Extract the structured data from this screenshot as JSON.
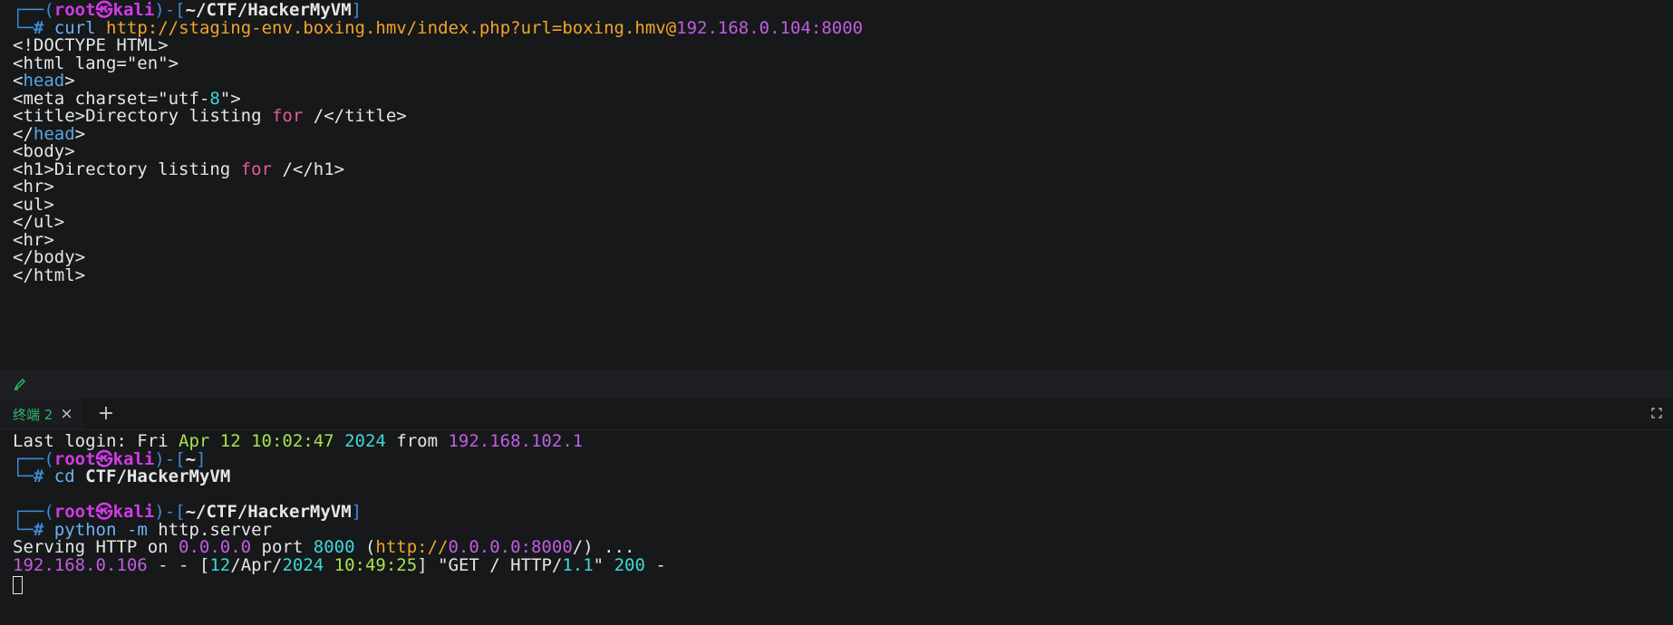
{
  "top_terminal": {
    "prompt": {
      "open": "┌──(",
      "user": "root㉿kali",
      "mid": ")-[",
      "path": "~/CTF/HackerMyVM",
      "close": "]",
      "corner": "└─",
      "hash": "#"
    },
    "command": {
      "name": "curl",
      "url_part": "http://staging-env.boxing.hmv/index.php?url=boxing.hmv@",
      "ip_port": "192.168.0.104:8000"
    },
    "output": {
      "l1": "<!DOCTYPE HTML>",
      "l2": "<html lang=\"en\">",
      "l3a": "<",
      "l3b": "head",
      "l3c": ">",
      "l4a": "<meta charset=\"utf-",
      "l4b": "8",
      "l4c": "\">",
      "l5a": "<title>Directory listing ",
      "l5b": "for",
      "l5c": " /</title>",
      "l6a": "</",
      "l6b": "head",
      "l6c": ">",
      "l7": "<body>",
      "l8a": "<h1>Directory listing ",
      "l8b": "for",
      "l8c": " /</h1>",
      "l9": "<hr>",
      "l10": "<ul>",
      "l11": "</ul>",
      "l12": "<hr>",
      "l13": "</body>",
      "l14": "</html>"
    }
  },
  "tabbar": {
    "tab_label": "终端 2",
    "close_glyph": "×",
    "add_glyph": "+"
  },
  "bottom_terminal": {
    "last_login": {
      "prefix": "Last login: Fri ",
      "date": "Apr 12 10:02:47",
      "year": "2024",
      "from": " from ",
      "ip": "192.168.102.1"
    },
    "prompt1": {
      "open": "┌──(",
      "user": "root㉿kali",
      "mid": ")-[",
      "path": "~",
      "close": "]",
      "corner": "└─",
      "hash": "#"
    },
    "cmd1": {
      "name": "cd",
      "arg": "CTF/HackerMyVM"
    },
    "prompt2": {
      "open": "┌──(",
      "user": "root㉿kali",
      "mid": ")-[",
      "path": "~/CTF/HackerMyVM",
      "close": "]",
      "corner": "└─",
      "hash": "#"
    },
    "cmd2": {
      "name": "python",
      "flag": "-m",
      "arg": "http.server"
    },
    "serving": {
      "a": "Serving HTTP on ",
      "ip": "0.0.0.0",
      "b": " port ",
      "port": "8000",
      "c": " (",
      "proto": "http://",
      "url": "0.0.0.0:8000",
      "d": "/) ..."
    },
    "log": {
      "ip": "192.168.0.106",
      "a": " - - [",
      "day": "12",
      "b": "/Apr/",
      "year": "2024",
      "c": " ",
      "time": "10:49:25",
      "d": "] \"GET / HTTP/",
      "ver": "1.1",
      "e": "\" ",
      "status": "200",
      "f": " -"
    }
  },
  "colors": {
    "background": "#16181a",
    "prompt_box": "#3e8bd6",
    "prompt_user": "#d23be6",
    "url": "#f0a52a",
    "ip": "#c15de0",
    "number": "#3fd8d8",
    "keyword": "#e55d8f",
    "tab_label": "#2fb86c"
  },
  "icons": {
    "splitter": "pen-icon",
    "maximize": "maximize-icon"
  }
}
